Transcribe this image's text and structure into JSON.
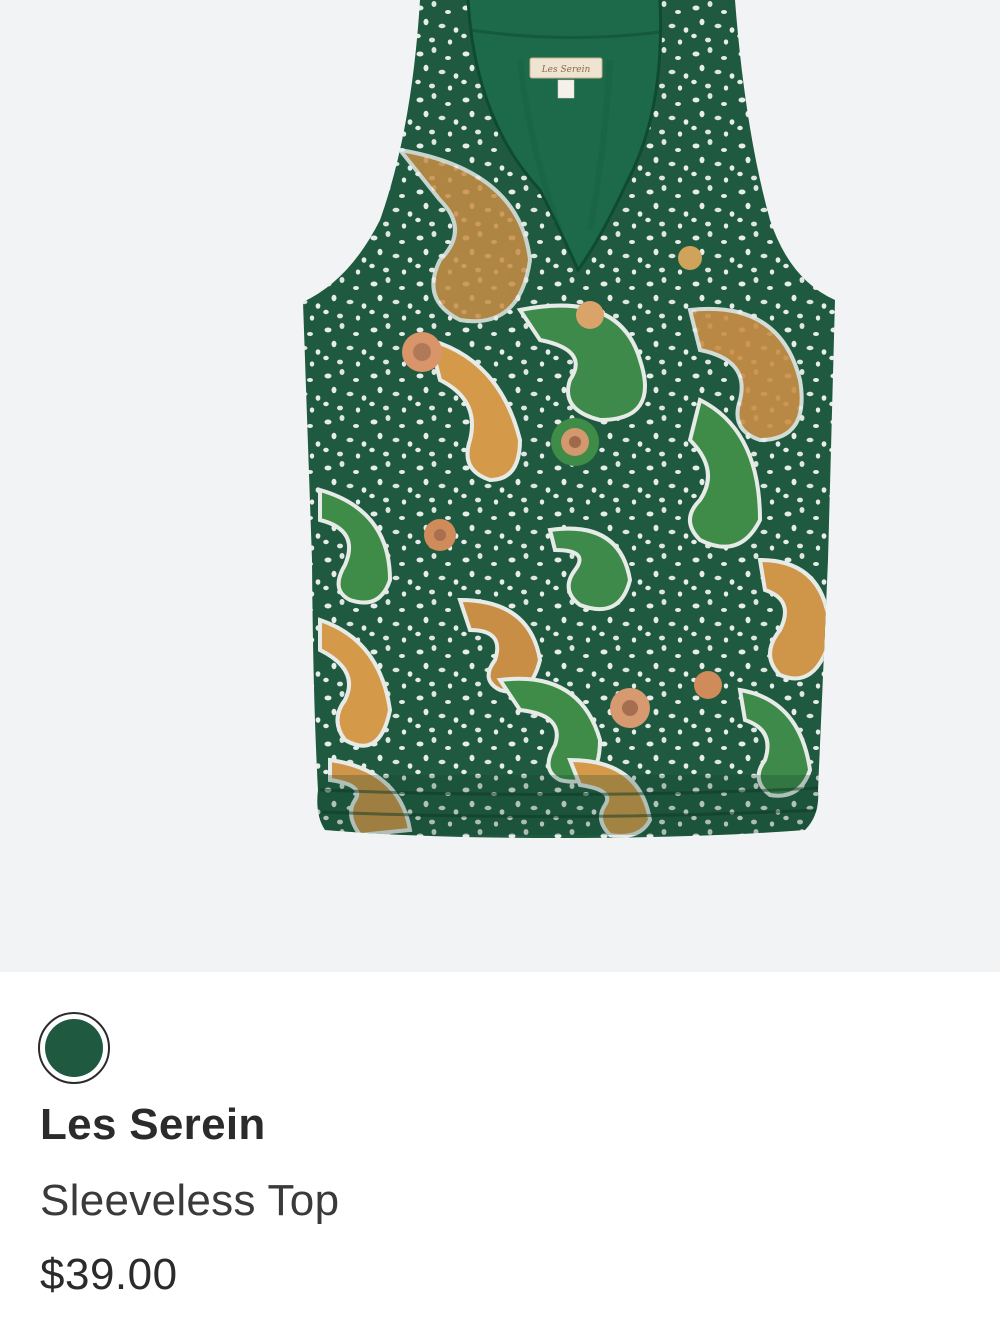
{
  "product": {
    "image_alt": "Green paisley print sleeveless top",
    "garment_label_text": "Les Serein",
    "color_swatch": {
      "color": "#1f5a40",
      "selected": true
    },
    "brand": "Les Serein",
    "name": "Sleeveless Top",
    "price": "$39.00"
  },
  "colors": {
    "image_background": "#f2f3f4",
    "fabric_base": "#1f5a40",
    "fabric_pattern_light": "#e8ecea",
    "fabric_pattern_orange": "#d99a4e",
    "fabric_pattern_green": "#4f9a4c"
  }
}
